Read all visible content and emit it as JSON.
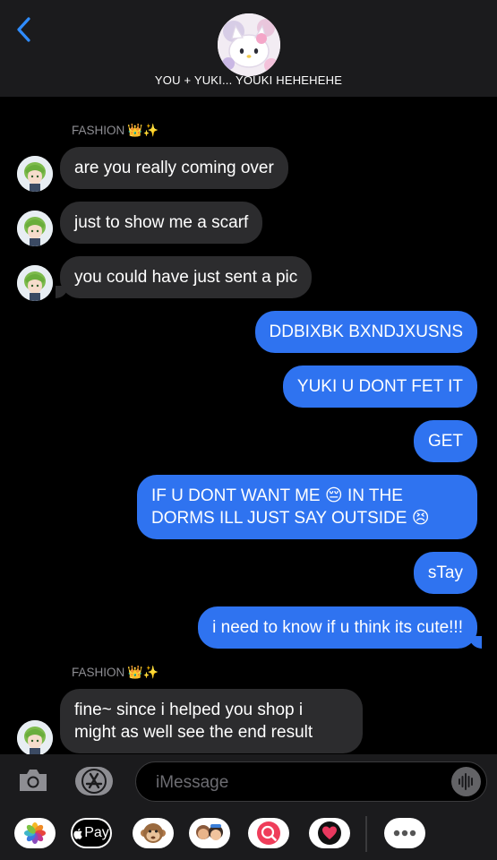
{
  "header": {
    "title": "YOU + YUKI... YOUKI HEHEHEHE",
    "back_icon": "chevron-left-icon",
    "accent": "#2f8cff"
  },
  "messages": [
    {
      "type": "name",
      "text": "FASHION",
      "emoji": "👑✨"
    },
    {
      "type": "in",
      "text": "are you really coming over"
    },
    {
      "type": "in",
      "text": "just to show me a scarf"
    },
    {
      "type": "in",
      "text": "you could have just sent a pic"
    },
    {
      "type": "out",
      "text": "DDBIXBK BXNDJXUSNS"
    },
    {
      "type": "out",
      "text": "YUKI U DONT FET IT"
    },
    {
      "type": "out",
      "text": "GET"
    },
    {
      "type": "out",
      "text": "IF U DONT WANT ME 😔 IN THE DORMS ILL JUST SAY OUTSIDE 😣"
    },
    {
      "type": "out",
      "text": "sTay"
    },
    {
      "type": "out",
      "text": "i need to know if u think its cute!!!"
    },
    {
      "type": "name",
      "text": "FASHION",
      "emoji": "👑✨"
    },
    {
      "type": "in",
      "text": "fine~ since i helped you shop i might as well see the end result"
    }
  ],
  "input": {
    "placeholder": "iMessage",
    "camera_icon": "camera-icon",
    "appstore_icon": "app-store-icon",
    "audio_icon": "audio-waveform-icon"
  },
  "drawer": {
    "apple_pay_label": "Pay",
    "apps": [
      "photos-icon",
      "apple-pay-icon",
      "animoji-icon",
      "memoji-icon",
      "search-images-icon",
      "digital-touch-icon",
      "more-icon"
    ]
  },
  "colors": {
    "incoming_bubble": "#2c2c2e",
    "outgoing_bubble": "#2f73f0",
    "background": "#000000",
    "bar": "#1b1b1d"
  }
}
